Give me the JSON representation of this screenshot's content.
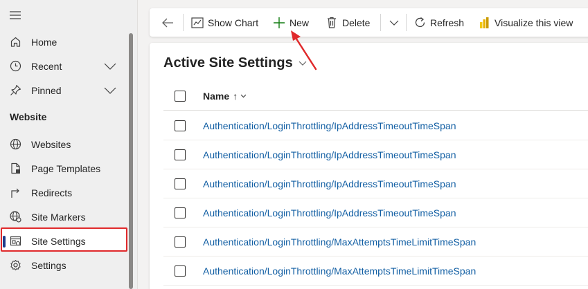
{
  "sidebar": {
    "items_top": [
      {
        "label": "Home",
        "icon": "home-icon"
      },
      {
        "label": "Recent",
        "icon": "clock-icon",
        "expandable": true
      },
      {
        "label": "Pinned",
        "icon": "pin-icon",
        "expandable": true
      }
    ],
    "section": "Website",
    "items_website": [
      {
        "label": "Websites",
        "icon": "globe-icon"
      },
      {
        "label": "Page Templates",
        "icon": "page-template-icon"
      },
      {
        "label": "Redirects",
        "icon": "redirect-icon"
      },
      {
        "label": "Site Markers",
        "icon": "site-marker-icon"
      },
      {
        "label": "Site Settings",
        "icon": "site-settings-icon",
        "selected": true
      },
      {
        "label": "Settings",
        "icon": "gear-icon"
      }
    ]
  },
  "toolbar": {
    "back_icon": "back-arrow-icon",
    "show_chart": "Show Chart",
    "new": "New",
    "delete": "Delete",
    "refresh": "Refresh",
    "visualize": "Visualize this view"
  },
  "view": {
    "title": "Active Site Settings",
    "column_name": "Name",
    "sort_indicator": "↑",
    "rows": [
      "Authentication/LoginThrottling/IpAddressTimeoutTimeSpan",
      "Authentication/LoginThrottling/IpAddressTimeoutTimeSpan",
      "Authentication/LoginThrottling/IpAddressTimeoutTimeSpan",
      "Authentication/LoginThrottling/IpAddressTimeoutTimeSpan",
      "Authentication/LoginThrottling/MaxAttemptsTimeLimitTimeSpan",
      "Authentication/LoginThrottling/MaxAttemptsTimeLimitTimeSpan"
    ]
  },
  "colors": {
    "link": "#115ea3",
    "highlight": "#e0292b",
    "selected_bar": "#1f3c8a",
    "new_plus": "#107c10",
    "powerbi": "#f2c811"
  }
}
